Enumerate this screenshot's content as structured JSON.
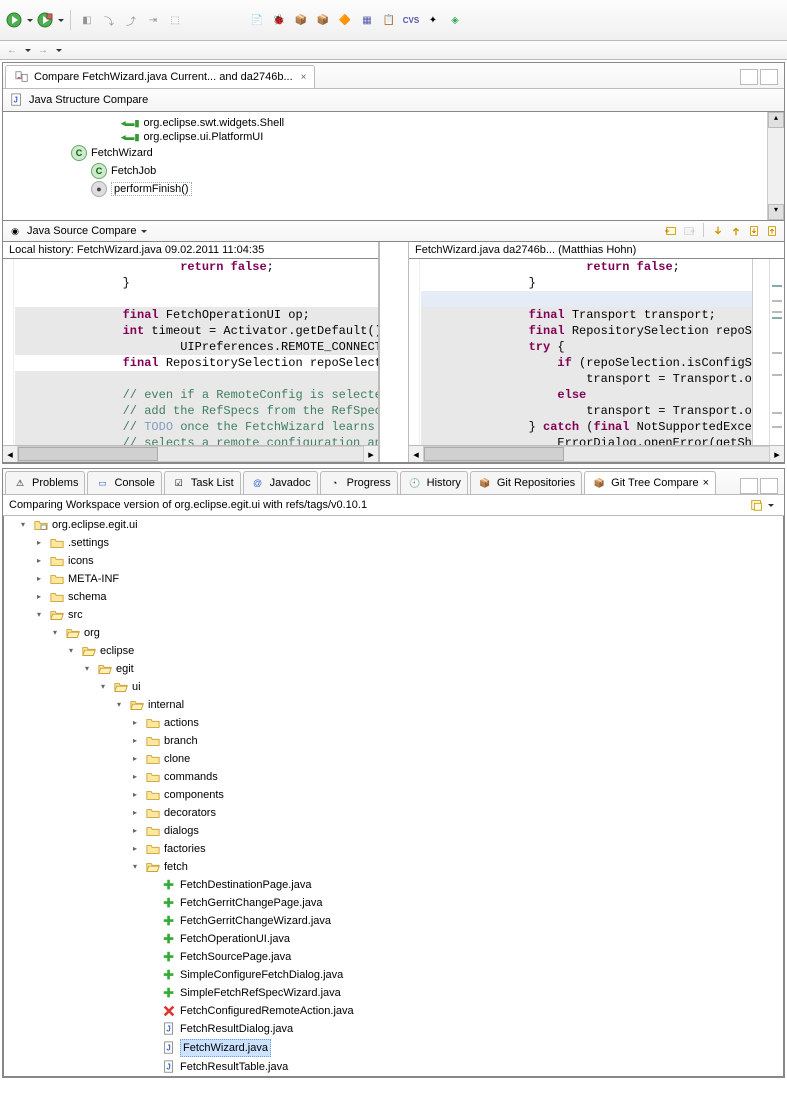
{
  "toolbar": {
    "run_mode": "Run",
    "debug_mode": "Debug"
  },
  "compare_tab": {
    "label": "Compare FetchWizard.java Current... and da2746b...",
    "close": "×"
  },
  "struct_section_title": "Java Structure Compare",
  "struct_rows": [
    {
      "indent": 110,
      "icon": "import",
      "label": "org.eclipse.swt.widgets.Shell"
    },
    {
      "indent": 110,
      "icon": "import",
      "label": "org.eclipse.ui.PlatformUI"
    },
    {
      "indent": 60,
      "icon": "class",
      "label": "FetchWizard"
    },
    {
      "indent": 80,
      "icon": "class",
      "label": "FetchJob"
    },
    {
      "indent": 80,
      "icon": "method",
      "label": "performFinish()",
      "sel": true
    }
  ],
  "src_section_title": "Java Source Compare",
  "left_pane_title": "Local history: FetchWizard.java 09.02.2011 11:04:35",
  "right_pane_title": "FetchWizard.java da2746b... (Matthias Hohn)",
  "left_code": [
    {
      "cls": "cl",
      "html": "                <span class='kw'>return</span> <span class='kw'>false</span>;"
    },
    {
      "cls": "cl",
      "html": "        }"
    },
    {
      "cls": "cl",
      "html": ""
    },
    {
      "cls": "cl diff-del",
      "html": "        <span class='kw'>final</span> FetchOperationUI op;"
    },
    {
      "cls": "cl diff-del",
      "html": "        <span class='kw'>int</span> timeout = Activator.getDefault().g"
    },
    {
      "cls": "cl diff-del",
      "html": "                UIPreferences.REMOTE_CONNECTIO"
    },
    {
      "cls": "cl",
      "html": "        <span class='kw'>final</span> RepositorySelection repoSelectio"
    },
    {
      "cls": "cl diff-del",
      "html": ""
    },
    {
      "cls": "cl diff-del",
      "html": "        <span class='cm'>// even if a RemoteConfig is selected,</span>"
    },
    {
      "cls": "cl diff-del",
      "html": "        <span class='cm'>// add the RefSpecs from the RefSpec p</span>"
    },
    {
      "cls": "cl diff-del",
      "html": "        <span class='cm'>// </span><span class='todo'>TODO</span><span class='cm'> once the FetchWizard learns to</span>"
    },
    {
      "cls": "cl diff-del",
      "html": "        <span class='cm'>// selects a remote configuration and </span>"
    }
  ],
  "right_code": [
    {
      "cls": "cl",
      "html": "                <span class='kw'>return</span> <span class='kw'>false</span>;"
    },
    {
      "cls": "cl",
      "html": "        }"
    },
    {
      "cls": "cl diff-ins",
      "html": ""
    },
    {
      "cls": "cl diff-del",
      "html": "        <span class='kw'>final</span> Transport transport;"
    },
    {
      "cls": "cl diff-del",
      "html": "        <span class='kw'>final</span> RepositorySelection repoSele"
    },
    {
      "cls": "cl diff-del",
      "html": "        <span class='kw'>try</span> {"
    },
    {
      "cls": "cl diff-del",
      "html": "            <span class='kw'>if</span> (repoSelection.isConfigSele"
    },
    {
      "cls": "cl diff-del",
      "html": "                transport = Transport.open"
    },
    {
      "cls": "cl diff-del",
      "html": "            <span class='kw'>else</span>"
    },
    {
      "cls": "cl diff-del",
      "html": "                transport = Transport.open"
    },
    {
      "cls": "cl diff-del",
      "html": "        } <span class='kw'>catch</span> (<span class='kw'>final</span> NotSupportedExcepti"
    },
    {
      "cls": "cl diff-del",
      "html": "            ErrorDialog.openError(getShell"
    }
  ],
  "bottom_tabs": [
    {
      "label": "Problems",
      "name": "tab-problems"
    },
    {
      "label": "Console",
      "name": "tab-console"
    },
    {
      "label": "Task List",
      "name": "tab-tasklist"
    },
    {
      "label": "Javadoc",
      "name": "tab-javadoc"
    },
    {
      "label": "Progress",
      "name": "tab-progress"
    },
    {
      "label": "History",
      "name": "tab-history"
    },
    {
      "label": "Git Repositories",
      "name": "tab-git-repos"
    },
    {
      "label": "Git Tree Compare",
      "name": "tab-git-tree-compare",
      "active": true,
      "close": true
    }
  ],
  "status_line": "Comparing Workspace version of org.eclipse.egit.ui with refs/tags/v0.10.1",
  "tree": [
    {
      "d": 0,
      "tw": "exp",
      "ic": "proj",
      "label": "org.eclipse.egit.ui"
    },
    {
      "d": 1,
      "tw": "col",
      "ic": "folder",
      "label": ".settings"
    },
    {
      "d": 1,
      "tw": "col",
      "ic": "folder",
      "label": "icons"
    },
    {
      "d": 1,
      "tw": "col",
      "ic": "folder",
      "label": "META-INF"
    },
    {
      "d": 1,
      "tw": "col",
      "ic": "folder",
      "label": "schema"
    },
    {
      "d": 1,
      "tw": "exp",
      "ic": "folder",
      "label": "src"
    },
    {
      "d": 2,
      "tw": "exp",
      "ic": "folder",
      "label": "org"
    },
    {
      "d": 3,
      "tw": "exp",
      "ic": "folder",
      "label": "eclipse"
    },
    {
      "d": 4,
      "tw": "exp",
      "ic": "folder",
      "label": "egit"
    },
    {
      "d": 5,
      "tw": "exp",
      "ic": "folder",
      "label": "ui"
    },
    {
      "d": 6,
      "tw": "exp",
      "ic": "folder",
      "label": "internal"
    },
    {
      "d": 7,
      "tw": "col",
      "ic": "folder",
      "label": "actions"
    },
    {
      "d": 7,
      "tw": "col",
      "ic": "folder",
      "label": "branch"
    },
    {
      "d": 7,
      "tw": "col",
      "ic": "folder",
      "label": "clone"
    },
    {
      "d": 7,
      "tw": "col",
      "ic": "folder",
      "label": "commands"
    },
    {
      "d": 7,
      "tw": "col",
      "ic": "folder",
      "label": "components"
    },
    {
      "d": 7,
      "tw": "col",
      "ic": "folder",
      "label": "decorators"
    },
    {
      "d": 7,
      "tw": "col",
      "ic": "folder",
      "label": "dialogs"
    },
    {
      "d": 7,
      "tw": "col",
      "ic": "folder",
      "label": "factories"
    },
    {
      "d": 7,
      "tw": "exp",
      "ic": "folder",
      "label": "fetch"
    },
    {
      "d": 8,
      "tw": "none",
      "ic": "add",
      "label": "FetchDestinationPage.java"
    },
    {
      "d": 8,
      "tw": "none",
      "ic": "add",
      "label": "FetchGerritChangePage.java"
    },
    {
      "d": 8,
      "tw": "none",
      "ic": "add",
      "label": "FetchGerritChangeWizard.java"
    },
    {
      "d": 8,
      "tw": "none",
      "ic": "add",
      "label": "FetchOperationUI.java"
    },
    {
      "d": 8,
      "tw": "none",
      "ic": "add",
      "label": "FetchSourcePage.java"
    },
    {
      "d": 8,
      "tw": "none",
      "ic": "add",
      "label": "SimpleConfigureFetchDialog.java"
    },
    {
      "d": 8,
      "tw": "none",
      "ic": "add",
      "label": "SimpleFetchRefSpecWizard.java"
    },
    {
      "d": 8,
      "tw": "none",
      "ic": "del",
      "label": "FetchConfiguredRemoteAction.java"
    },
    {
      "d": 8,
      "tw": "none",
      "ic": "jfile",
      "label": "FetchResultDialog.java"
    },
    {
      "d": 8,
      "tw": "none",
      "ic": "jfile",
      "label": "FetchWizard.java",
      "sel": true
    },
    {
      "d": 8,
      "tw": "none",
      "ic": "jfile",
      "label": "FetchResultTable.java"
    }
  ]
}
